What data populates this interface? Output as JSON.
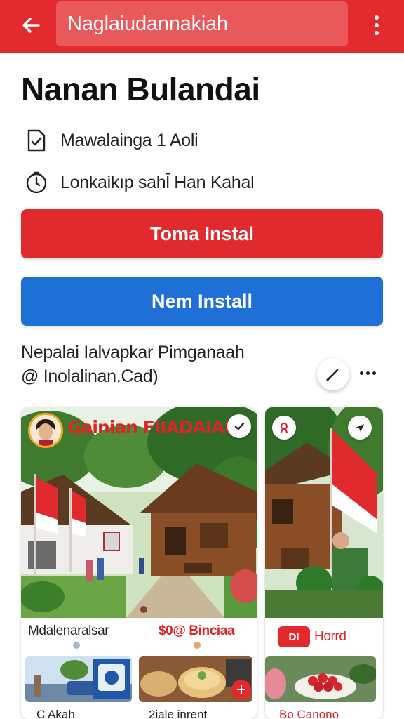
{
  "header": {
    "search_text": "Naglaiudannakiah",
    "accent_color": "#e32b2d",
    "back_icon": "arrow-left-icon",
    "menu_icon": "more-vert-icon"
  },
  "main": {
    "title": "Nanan Bulandai",
    "info": [
      {
        "icon": "calendar-check-icon",
        "text": "Mawalainga 1 Aoli"
      },
      {
        "icon": "clock-icon",
        "text": "Lonkaikıp sahl̄ Han Kahal"
      }
    ],
    "primary_button": "Toma Instal",
    "secondary_button": "Nem Install",
    "primary_color": "#e12a2e",
    "secondary_color": "#1e6fd6"
  },
  "section": {
    "title": "Nepalai Ialvapkar Pimganaah",
    "subtitle": "@ Inolalinan.Cad)"
  },
  "cards": [
    {
      "header_text": "Gainian FIIADAIAI",
      "bottom_left": "Mdalenaralsar",
      "bottom_right": "$0@ Binciaa",
      "footer_left": "C Akah",
      "footer_right": "2iale inrent"
    },
    {
      "badge_text": "Horrd",
      "badge_label": "DI",
      "footer_text": "Bo Canono"
    }
  ]
}
